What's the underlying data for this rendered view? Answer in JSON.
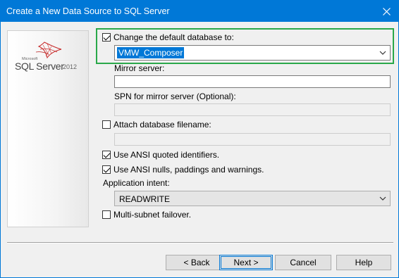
{
  "window": {
    "title": "Create a New Data Source to SQL Server"
  },
  "logo": {
    "microsoft": "Microsoft",
    "product": "SQL Server",
    "version": "2012"
  },
  "options": {
    "change_default_db": {
      "label": "Change the default database to:",
      "checked": true
    },
    "database_value": "VMW_Composer",
    "mirror_server": {
      "label": "Mirror server:",
      "value": ""
    },
    "spn_mirror": {
      "label": "SPN for mirror server (Optional):",
      "value": ""
    },
    "attach_db_filename": {
      "label": "Attach database filename:",
      "checked": false,
      "value": ""
    },
    "ansi_quoted": {
      "label": "Use ANSI quoted identifiers.",
      "checked": true
    },
    "ansi_nulls": {
      "label": "Use ANSI nulls, paddings and warnings.",
      "checked": true
    },
    "app_intent": {
      "label": "Application intent:",
      "value": "READWRITE"
    },
    "multi_subnet": {
      "label": "Multi-subnet failover.",
      "checked": false
    }
  },
  "buttons": {
    "back": "< Back",
    "next": "Next >",
    "cancel": "Cancel",
    "help": "Help"
  },
  "icons": {
    "close": "close-icon",
    "dropdown": "chevron-down-icon"
  },
  "colors": {
    "titlebar": "#0078d7",
    "highlight_box": "#2aa84a",
    "selection": "#0078d7"
  }
}
